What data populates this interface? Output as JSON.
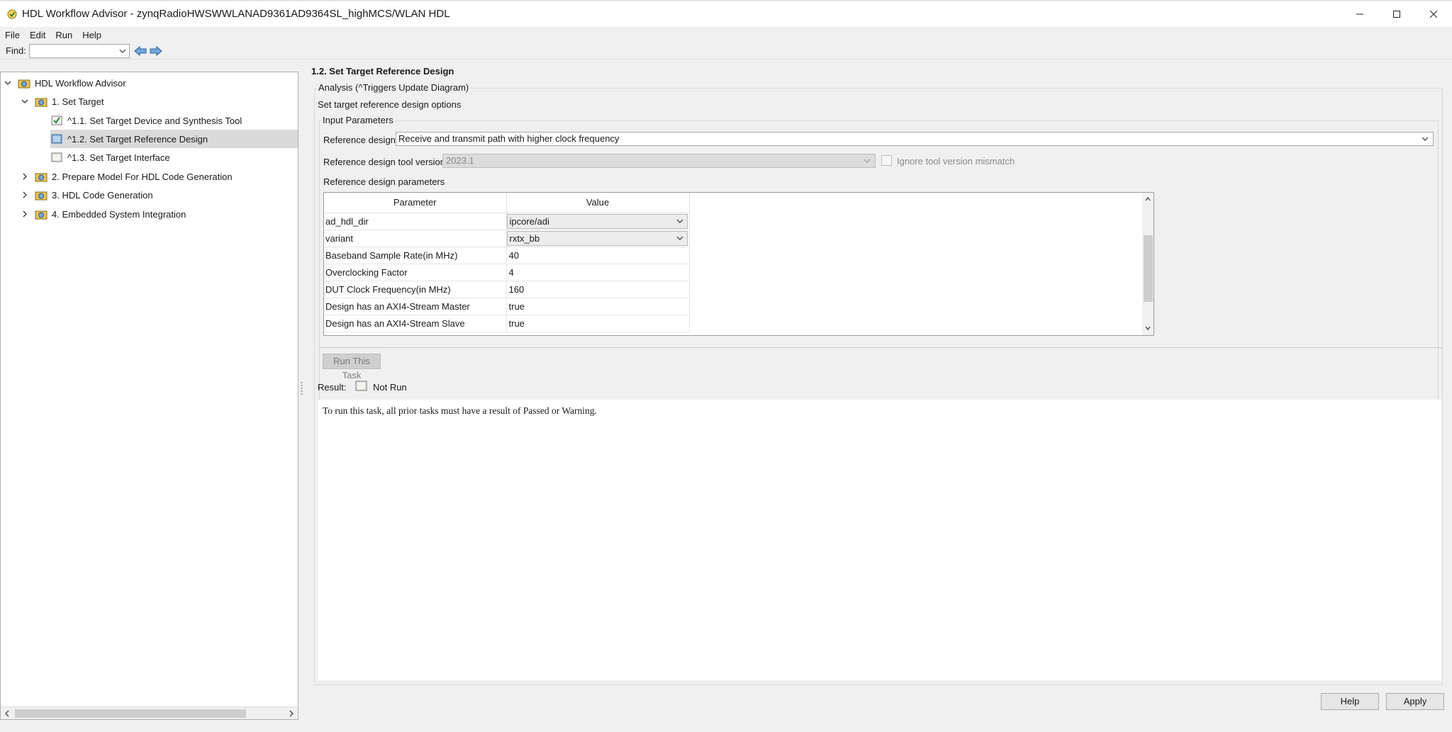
{
  "window": {
    "title": "HDL Workflow Advisor - zynqRadioHWSWWLANAD9361AD9364SL_highMCS/WLAN HDL"
  },
  "menu": [
    "File",
    "Edit",
    "Run",
    "Help"
  ],
  "find": {
    "label": "Find:",
    "value": ""
  },
  "tree": {
    "items": [
      {
        "label": "HDL Workflow Advisor",
        "icon": "advisor-folder-icon",
        "expander": "expanded"
      },
      {
        "label": "1. Set Target",
        "icon": "task-folder-icon",
        "expander": "expanded"
      },
      {
        "label": "^1.1. Set Target Device and Synthesis Tool",
        "icon": "task-passed-icon",
        "expander": "none"
      },
      {
        "label": "^1.2. Set Target Reference Design",
        "icon": "task-icon",
        "expander": "none",
        "selected": true
      },
      {
        "label": "^1.3. Set Target Interface",
        "icon": "task-notrun-icon",
        "expander": "none"
      },
      {
        "label": "2. Prepare Model For HDL Code Generation",
        "icon": "task-folder-icon",
        "expander": "collapsed"
      },
      {
        "label": "3. HDL Code Generation",
        "icon": "task-folder-icon",
        "expander": "collapsed"
      },
      {
        "label": "4. Embedded System Integration",
        "icon": "task-folder-icon",
        "expander": "collapsed"
      }
    ]
  },
  "task": {
    "title": "1.2. Set Target Reference Design",
    "analysis_legend": "Analysis (^Triggers Update Diagram)",
    "subtitle": "Set target reference design options",
    "input_legend": "Input Parameters",
    "ref_design_label": "Reference design:",
    "ref_design_value": "Receive and transmit path with higher clock frequency",
    "tool_version_label": "Reference design tool version:",
    "tool_version_value": "2023.1",
    "ignore_label": "Ignore tool version mismatch",
    "params_label": "Reference design parameters",
    "params_headers": [
      "Parameter",
      "Value"
    ],
    "params": [
      {
        "name": "ad_hdl_dir",
        "value": "ipcore/adi"
      },
      {
        "name": "variant",
        "value": "rxtx_bb"
      },
      {
        "name": "Baseband Sample Rate(in MHz)",
        "value": "40"
      },
      {
        "name": "Overclocking Factor",
        "value": "4"
      },
      {
        "name": "DUT Clock Frequency(in MHz)",
        "value": "160"
      },
      {
        "name": "Design has an AXI4-Stream Master",
        "value": "true"
      },
      {
        "name": "Design has an AXI4-Stream Slave",
        "value": "true"
      }
    ],
    "run_button": "Run This Task",
    "result_label": "Result:",
    "result_value": "Not Run",
    "message": "To run this task, all prior tasks must have a result of Passed or Warning."
  },
  "buttons": {
    "help": "Help",
    "apply": "Apply"
  }
}
